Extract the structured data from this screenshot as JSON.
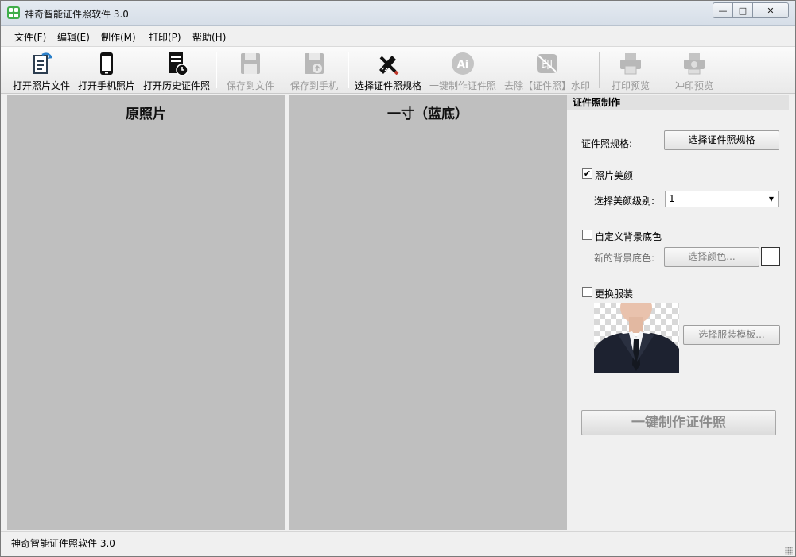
{
  "window": {
    "title": "神奇智能证件照软件 3.0",
    "min_glyph": "—",
    "max_glyph": "□",
    "close_glyph": "✕"
  },
  "menu": [
    {
      "label": "文件(F)"
    },
    {
      "label": "编辑(E)"
    },
    {
      "label": "制作(M)"
    },
    {
      "label": "打印(P)"
    },
    {
      "label": "帮助(H)"
    }
  ],
  "toolbar": {
    "items": [
      {
        "label": "打开照片文件",
        "icon": "open-photo-file-icon",
        "enabled": true
      },
      {
        "label": "打开手机照片",
        "icon": "phone-icon",
        "enabled": true
      },
      {
        "label": "打开历史证件照",
        "icon": "history-document-icon",
        "enabled": true
      },
      {
        "label": "保存到文件",
        "icon": "save-floppy-icon",
        "enabled": false
      },
      {
        "label": "保存到手机",
        "icon": "save-to-phone-icon",
        "enabled": false
      },
      {
        "label": "选择证件照规格",
        "icon": "ruler-pencil-icon",
        "enabled": true
      },
      {
        "label": "一键制作证件照",
        "icon": "ai-icon",
        "enabled": false
      },
      {
        "label": "去除【证件照】水印",
        "icon": "remove-watermark-icon",
        "enabled": false
      },
      {
        "label": "打印预览",
        "icon": "printer-icon",
        "enabled": false
      },
      {
        "label": "冲印预览",
        "icon": "photo-print-icon",
        "enabled": false
      }
    ]
  },
  "panes": {
    "original_title": "原照片",
    "result_title": "一寸（蓝底）"
  },
  "panel": {
    "header": "证件照制作",
    "spec_label": "证件照规格:",
    "spec_button": "选择证件照规格",
    "beauty_checkbox": "照片美颜",
    "beauty_checked": true,
    "beauty_level_label": "选择美颜级别:",
    "beauty_level_value": "1",
    "custom_bg_checkbox": "自定义背景底色",
    "custom_bg_checked": false,
    "new_bg_label": "新的背景底色:",
    "choose_color_button": "选择颜色...",
    "swatch_color": "#ffffff",
    "change_clothes_checkbox": "更换服装",
    "change_clothes_checked": false,
    "clothes_template_button": "选择服装模板...",
    "make_button": "一键制作证件照"
  },
  "status": {
    "text": "神奇智能证件照软件 3.0"
  },
  "colors": {
    "pane_bg": "#bfbfbf",
    "window_bg": "#f0f0f0"
  }
}
